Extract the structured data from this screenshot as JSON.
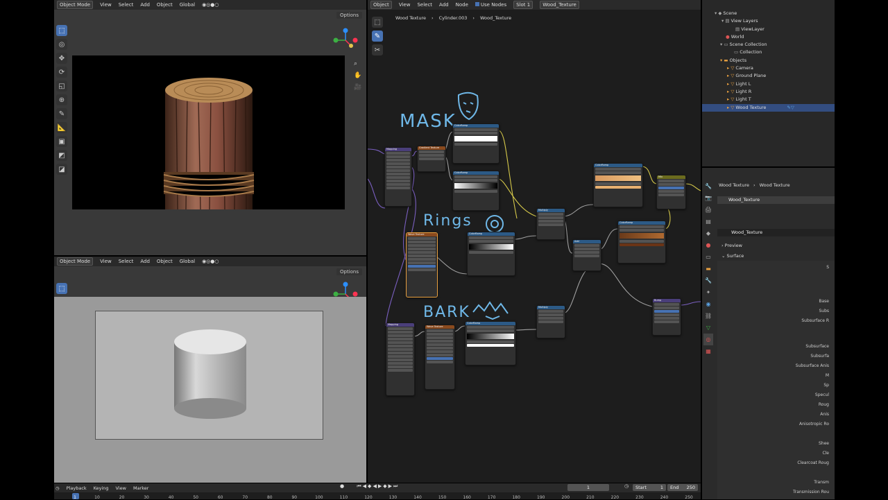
{
  "colors": {
    "accent": "#4772b3",
    "header_bg": "#2a2a2a",
    "node_editor_bg": "#1d1d1d",
    "viewport_bg": "#393939",
    "handwriting": "#6fb8e8",
    "node_header_blue": "#2c5a86",
    "node_header_orange": "#8a4a1e",
    "node_header_purple": "#4a3e7a",
    "node_header_yellow": "#6b6b1e",
    "wire_yellow": "#d6c94a",
    "wire_grey": "#a0a0a0",
    "wire_purple": "#7a5fc0"
  },
  "top_viewport": {
    "header": [
      "Object Mode",
      "View",
      "Select",
      "Add",
      "Object",
      "Global"
    ],
    "options_label": "Options"
  },
  "bottom_viewport": {
    "header": [
      "Object Mode",
      "View",
      "Select",
      "Add",
      "Object",
      "Global"
    ],
    "options_label": "Options"
  },
  "node_editor": {
    "header": [
      "Object",
      "View",
      "Select",
      "Add",
      "Node"
    ],
    "use_nodes_label": "Use Nodes",
    "slot_label": "Slot 1",
    "material_name": "Wood_Texture",
    "breadcrumb": [
      "Wood Texture",
      "Cylinder.003",
      "Wood_Texture"
    ],
    "annotations": [
      "MASK",
      "Rings",
      "BARK"
    ],
    "nodes": [
      {
        "title": "Mapping",
        "color": "#4a3e7a"
      },
      {
        "title": "Gradient Texture",
        "color": "#8a4a1e"
      },
      {
        "title": "ColorRamp",
        "color": "#2c5a86"
      },
      {
        "title": "ColorRamp",
        "color": "#2c5a86"
      },
      {
        "title": "ColorRamp",
        "color": "#2c5a86"
      },
      {
        "title": "Mix",
        "color": "#6b6b1e"
      },
      {
        "title": "Wave Texture",
        "color": "#8a4a1e"
      },
      {
        "title": "ColorRamp",
        "color": "#2c5a86"
      },
      {
        "title": "Multiply",
        "color": "#2c5a86"
      },
      {
        "title": "Add",
        "color": "#2c5a86"
      },
      {
        "title": "ColorRamp",
        "color": "#2c5a86"
      },
      {
        "title": "Bump",
        "color": "#4a3e7a"
      },
      {
        "title": "Mapping",
        "color": "#4a3e7a"
      },
      {
        "title": "Wave Texture",
        "color": "#8a4a1e"
      },
      {
        "title": "ColorRamp",
        "color": "#2c5a86"
      },
      {
        "title": "Multiply",
        "color": "#2c5a86"
      }
    ]
  },
  "outliner": {
    "items": [
      {
        "label": "Scene",
        "icon": "scene-icon"
      },
      {
        "label": "View Layers",
        "icon": "layers-icon"
      },
      {
        "label": "ViewLayer",
        "icon": "layer-icon"
      },
      {
        "label": "World",
        "icon": "world-icon"
      },
      {
        "label": "Scene Collection",
        "icon": "collection-icon"
      },
      {
        "label": "Collection",
        "icon": "collection-icon"
      },
      {
        "label": "Objects",
        "icon": "objects-icon"
      },
      {
        "label": "Camera",
        "icon": "camera-icon"
      },
      {
        "label": "Ground Plane",
        "icon": "mesh-icon"
      },
      {
        "label": "Light L",
        "icon": "light-icon"
      },
      {
        "label": "Light R",
        "icon": "light-icon"
      },
      {
        "label": "Light T",
        "icon": "light-icon"
      },
      {
        "label": "Wood Texture",
        "icon": "mesh-icon",
        "selected": true
      }
    ]
  },
  "properties": {
    "breadcrumb": [
      "Wood Texture",
      "Wood Texture"
    ],
    "material_slot": "Wood_Texture",
    "material_name": "Wood_Texture",
    "panels": [
      "Preview",
      "Surface"
    ],
    "surface_labels": [
      "S",
      "Base",
      "Subs",
      "Subsurface R",
      "Subsurface",
      "Subsurfa",
      "Subsurface Anis",
      "M",
      "Sp",
      "Specul",
      "Roug",
      "Anis",
      "Anisotropic Ro",
      "Shee",
      "Cle",
      "Clearcoat Roug",
      "Transm",
      "Transmission Rou"
    ]
  },
  "timeline": {
    "menu": [
      "Playback",
      "Keying",
      "View",
      "Marker"
    ],
    "current_frame": "1",
    "start_label": "Start",
    "start_value": "1",
    "end_label": "End",
    "end_value": "250",
    "ticks": [
      "1",
      "10",
      "20",
      "30",
      "40",
      "50",
      "60",
      "70",
      "80",
      "90",
      "100",
      "110",
      "120",
      "130",
      "140",
      "150",
      "160",
      "170",
      "180",
      "190",
      "200",
      "210",
      "220",
      "230",
      "240",
      "250"
    ]
  }
}
